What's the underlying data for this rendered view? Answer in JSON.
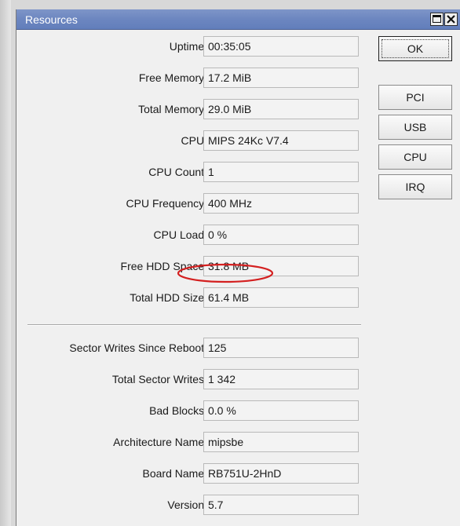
{
  "window": {
    "title": "Resources",
    "maximize_icon": "maximize-icon",
    "close_icon": "close-icon"
  },
  "fields": [
    {
      "label": "Uptime:",
      "value": "00:35:05"
    },
    {
      "label": "Free Memory:",
      "value": "17.2 MiB"
    },
    {
      "label": "Total Memory:",
      "value": "29.0 MiB"
    },
    {
      "label": "CPU:",
      "value": "MIPS 24Kc V7.4"
    },
    {
      "label": "CPU Count:",
      "value": "1"
    },
    {
      "label": "CPU Frequency:",
      "value": "400 MHz"
    },
    {
      "label": "CPU Load:",
      "value": "0 %"
    },
    {
      "label": "Free HDD Space:",
      "value": "31.8 MB"
    },
    {
      "label": "Total HDD Size:",
      "value": "61.4 MB"
    },
    {
      "label": "Sector Writes Since Reboot:",
      "value": "125"
    },
    {
      "label": "Total Sector Writes:",
      "value": "1 342"
    },
    {
      "label": "Bad Blocks:",
      "value": "0.0 %"
    },
    {
      "label": "Architecture Name:",
      "value": "mipsbe"
    },
    {
      "label": "Board Name:",
      "value": "RB751U-2HnD"
    },
    {
      "label": "Version:",
      "value": "5.7"
    }
  ],
  "buttons": {
    "ok": "OK",
    "pci": "PCI",
    "usb": "USB",
    "cpu": "CPU",
    "irq": "IRQ"
  },
  "colors": {
    "titlebar": "#6c86c0",
    "highlight_ellipse": "#d42020"
  }
}
